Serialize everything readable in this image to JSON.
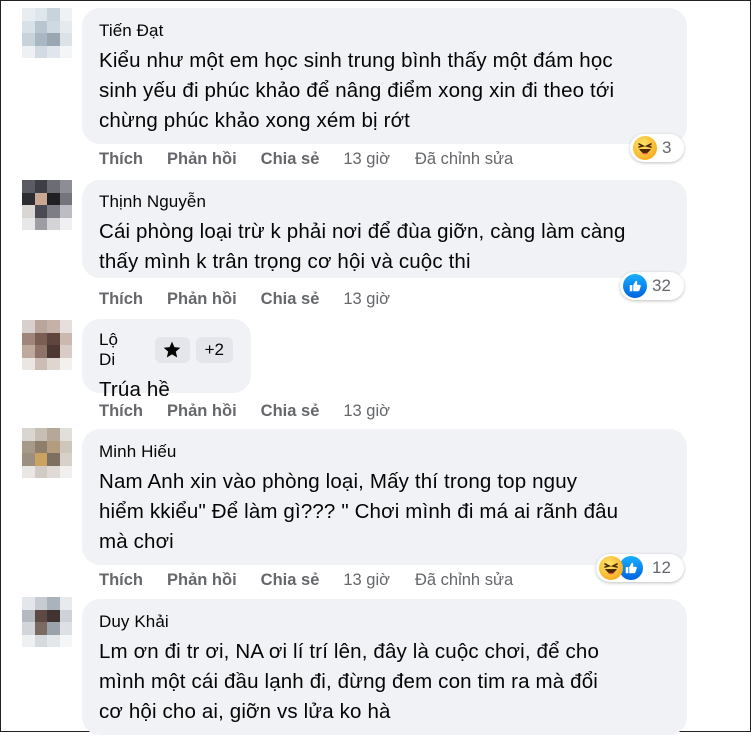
{
  "comments": [
    {
      "author": "Tiến Đạt",
      "text": "Kiểu như một em học sinh trung bình thấy một đám học\nsinh yếu đi phúc khảo để nâng điểm xong xin đi theo tới\nchừng phúc khảo xong xém bị rớt",
      "actions": {
        "like": "Thích",
        "reply": "Phản hồi",
        "share": "Chia sẻ",
        "time": "13 giờ",
        "edited": "Đã chỉnh sửa"
      },
      "reaction_count": "3",
      "reaction_types": [
        "haha-icon"
      ]
    },
    {
      "author": "Thịnh Nguyễn",
      "text": "Cái phòng loại trừ k phải nơi để đùa giỡn, càng làm càng\nthấy mình k trân trọng cơ hội và cuộc thi",
      "actions": {
        "like": "Thích",
        "reply": "Phản hồi",
        "share": "Chia sẻ",
        "time": "13 giờ"
      },
      "reaction_count": "32",
      "reaction_types": [
        "like-icon"
      ]
    },
    {
      "author": "Lộ Di",
      "badge_extra": "+2",
      "text": "Trúa hề",
      "actions": {
        "like": "Thích",
        "reply": "Phản hồi",
        "share": "Chia sẻ",
        "time": "13 giờ"
      }
    },
    {
      "author": "Minh Hiếu",
      "text": "Nam Anh xin vào phòng loại, Mấy thí trong top nguy\nhiểm kkiểu\" Để làm gì??? \" Chơi mình đi má ai rãnh đâu\nmà chơi",
      "actions": {
        "like": "Thích",
        "reply": "Phản hồi",
        "share": "Chia sẻ",
        "time": "13 giờ",
        "edited": "Đã chỉnh sửa"
      },
      "reaction_count": "12",
      "reaction_types": [
        "haha-icon",
        "like-icon"
      ]
    },
    {
      "author": "Duy Khải",
      "text": "Lm ơn đi tr ơi, NA ơi lí trí lên, đây là cuộc chơi, để cho\nmình một cái đầu lạnh đi, đừng đem con tim ra mà đổi\ncơ hội cho ai, giỡn vs lửa ko hà"
    }
  ],
  "colors": {
    "bubble_bg": "#f0f2f5",
    "meta_text": "#65676b",
    "like_blue": "#1877f2",
    "haha_yellow": "#f7b125"
  }
}
